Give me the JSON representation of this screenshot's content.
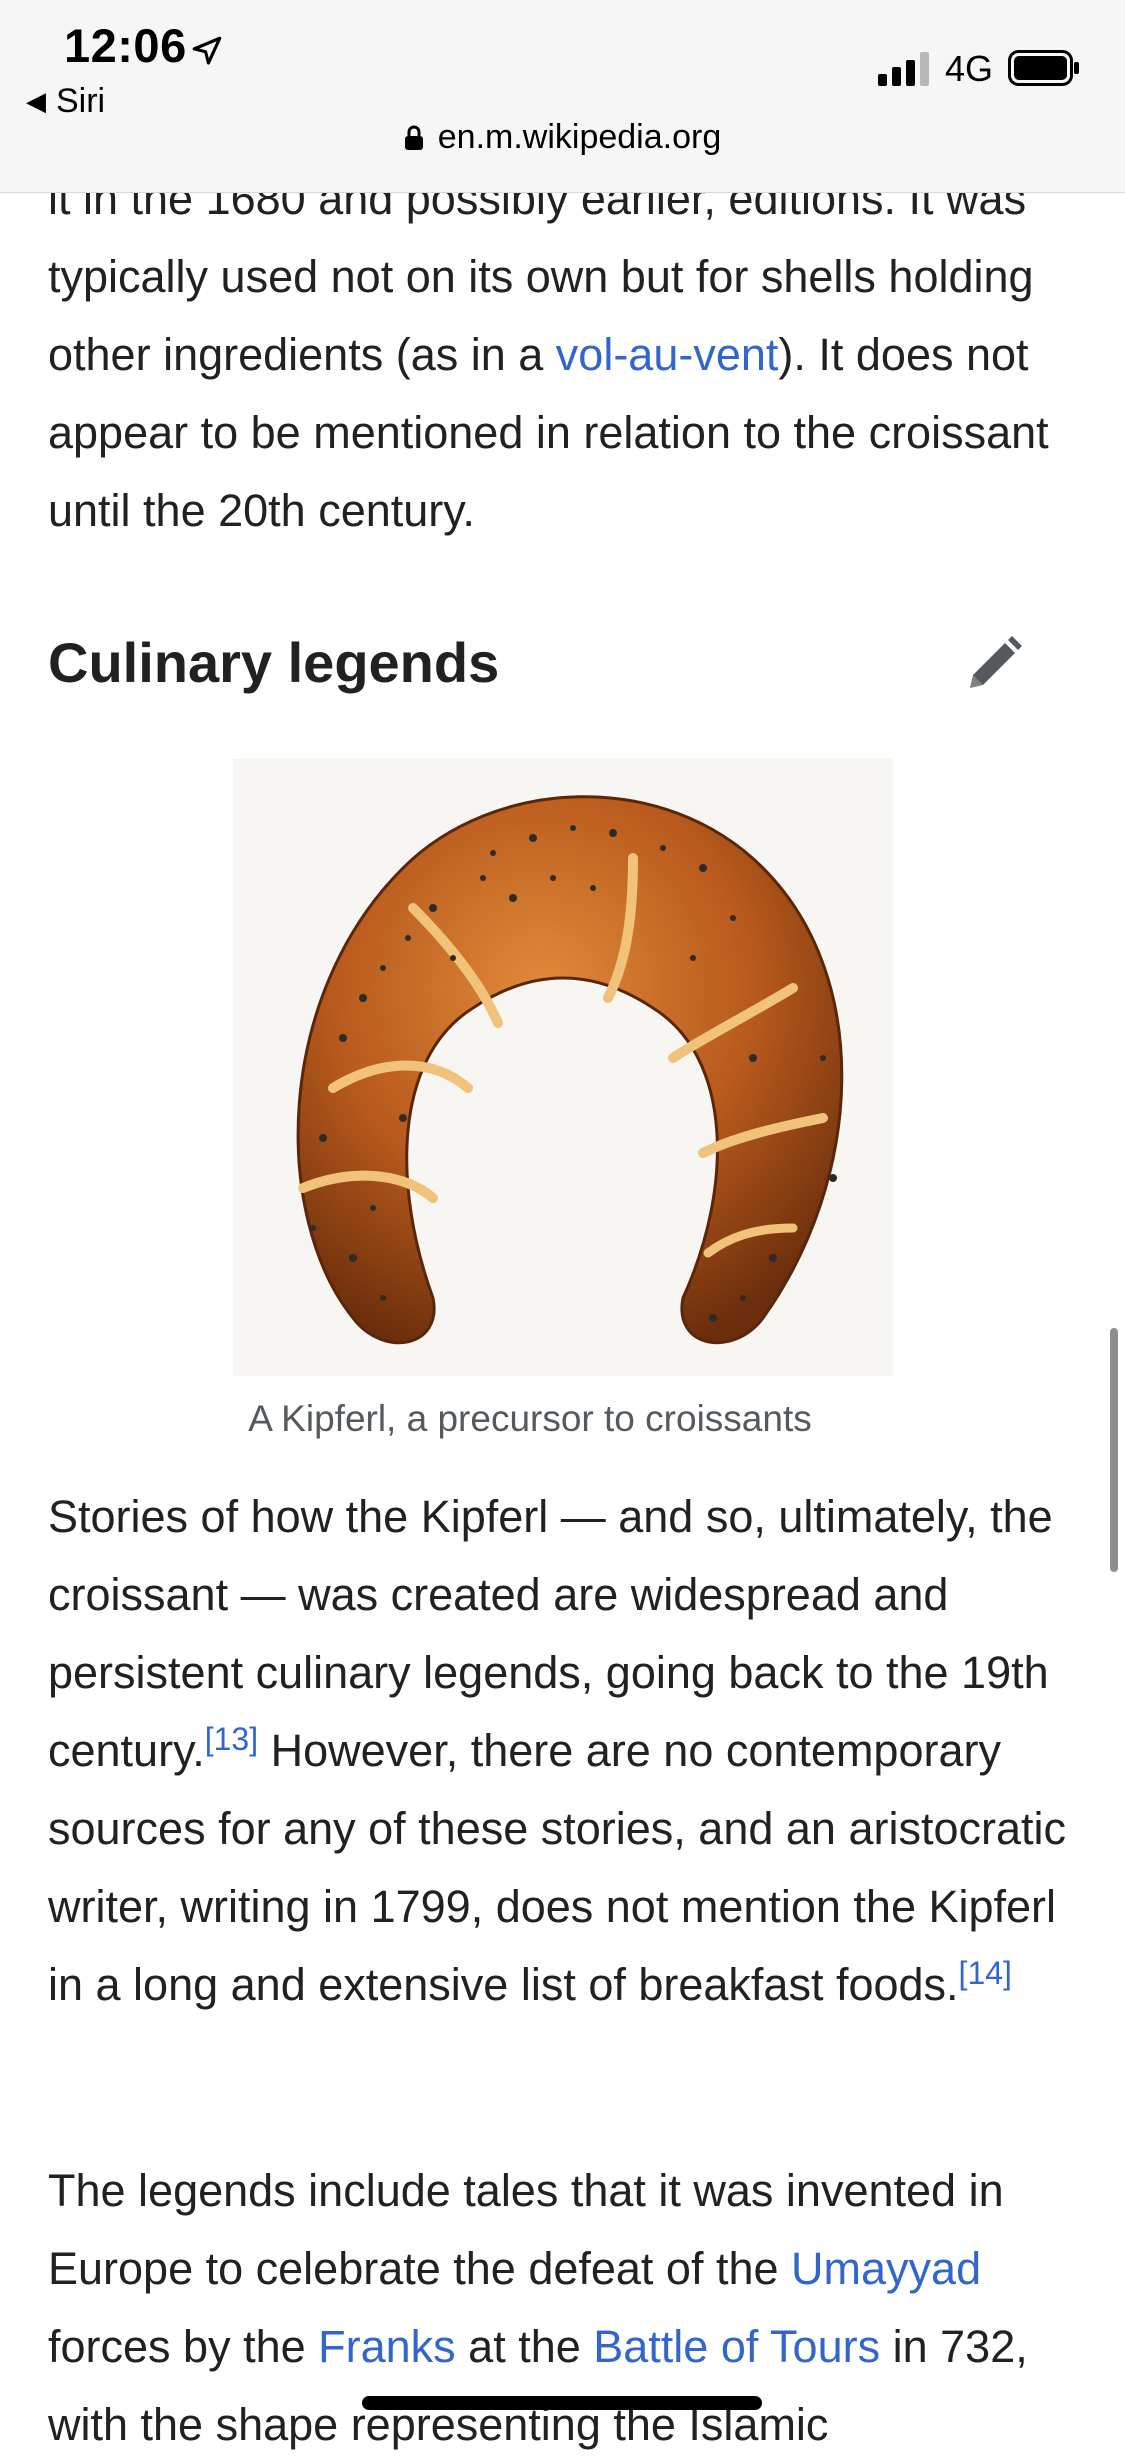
{
  "status_bar": {
    "time": "12:06",
    "back_app": "Siri",
    "network": "4G"
  },
  "url_bar": {
    "domain": "en.m.wikipedia.org"
  },
  "article": {
    "intro_para": {
      "t1": "it in the 1680 and possibly earlier, editions. It was typically used not on its own but for shells holding other ingredients (as in a ",
      "link1": "vol-au-vent",
      "t2": "). It does not appear to be mentioned in relation to the croissant until the 20th century."
    },
    "section": {
      "title": "Culinary legends",
      "edit_icon": "pencil-icon"
    },
    "figure": {
      "caption": "A Kipferl, a precursor to croissants"
    },
    "para2": {
      "t1": "Stories of how the Kipferl — and so, ultimately, the croissant — was created are widespread and persistent culinary legends, going back to the 19th century.",
      "ref1": "[13]",
      "t2": " However, there are no contemporary sources for any of these stories, and an aristocratic writer, writing in 1799, does not mention the Kipferl in a long and extensive list of breakfast foods.",
      "ref2": "[14]"
    },
    "para3": {
      "t1": "The legends include tales that it was invented in Europe to celebrate the defeat of the ",
      "link1": "Umayyad",
      "t2": " forces by the ",
      "link2": "Franks",
      "t3": " at the ",
      "link3": "Battle of Tours",
      "t4": " in 732, with the shape representing the Islamic"
    }
  },
  "colors": {
    "link": "#3366cc",
    "text": "#202122",
    "caption": "#54595d"
  }
}
